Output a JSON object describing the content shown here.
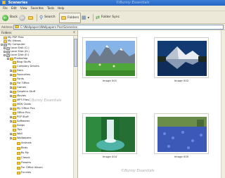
{
  "window": {
    "title": "Sceneries"
  },
  "menu": [
    "File",
    "Edit",
    "View",
    "Favorites",
    "Tools",
    "Help"
  ],
  "toolbar": {
    "back": "Back",
    "search": "Search",
    "folders": "Folders",
    "folder_sync": "Folder Sync"
  },
  "address": {
    "label": "Address",
    "value": "C:\\Wallpapers\\Wallpapers Pics\\Sceneries"
  },
  "panel": {
    "title": "Folders",
    "close": "x"
  },
  "tree": [
    {
      "label": "My PSP Files",
      "icon": "folder"
    },
    {
      "label": "My Videos",
      "icon": "folder"
    },
    {
      "label": "My Computer",
      "icon": "computer"
    },
    {
      "label": "Local Disk (C:)",
      "icon": "drive"
    },
    {
      "label": "Local Disk (D:)",
      "icon": "drive"
    },
    {
      "label": "Local Disk (E:)",
      "icon": "drive"
    },
    {
      "label": "Photoshop",
      "icon": "folder"
    },
    {
      "label": "Blog Stuffs",
      "icon": "folder"
    },
    {
      "label": "Company Drivers",
      "icon": "folder"
    },
    {
      "label": "Docs",
      "icon": "folder"
    },
    {
      "label": "Favourites",
      "icon": "folder"
    },
    {
      "label": "Fonts",
      "icon": "folder"
    },
    {
      "label": "For Office",
      "icon": "folder"
    },
    {
      "label": "Games",
      "icon": "folder"
    },
    {
      "label": "Graphics Stuff",
      "icon": "folder"
    },
    {
      "label": "Movies",
      "icon": "folder"
    },
    {
      "label": "MP3 Files",
      "icon": "folder"
    },
    {
      "label": "MSN Chats",
      "icon": "folder"
    },
    {
      "label": "My Office Pics",
      "icon": "folder"
    },
    {
      "label": "Office Pics",
      "icon": "folder"
    },
    {
      "label": "PSP Stuff",
      "icon": "folder"
    },
    {
      "label": "Softwares",
      "icon": "folder"
    },
    {
      "label": "Songs",
      "icon": "folder"
    },
    {
      "label": "Tips",
      "icon": "folder"
    },
    {
      "label": "Wall",
      "icon": "folder"
    },
    {
      "label": "Wallpapers",
      "icon": "folder"
    },
    {
      "label": "Animals",
      "icon": "folder"
    },
    {
      "label": "Birds",
      "icon": "folder"
    },
    {
      "label": "Bs My",
      "icon": "folder"
    },
    {
      "label": "Classic",
      "icon": "folder"
    },
    {
      "label": "Flowers",
      "icon": "folder"
    },
    {
      "label": "For Office Album",
      "icon": "folder"
    },
    {
      "label": "Funnies",
      "icon": "folder"
    }
  ],
  "images": [
    {
      "caption": "Image 001"
    },
    {
      "caption": "Image 002"
    },
    {
      "caption": "Image 004"
    },
    {
      "caption": "Image 005"
    }
  ],
  "watermark": "©Bunny Essentials"
}
